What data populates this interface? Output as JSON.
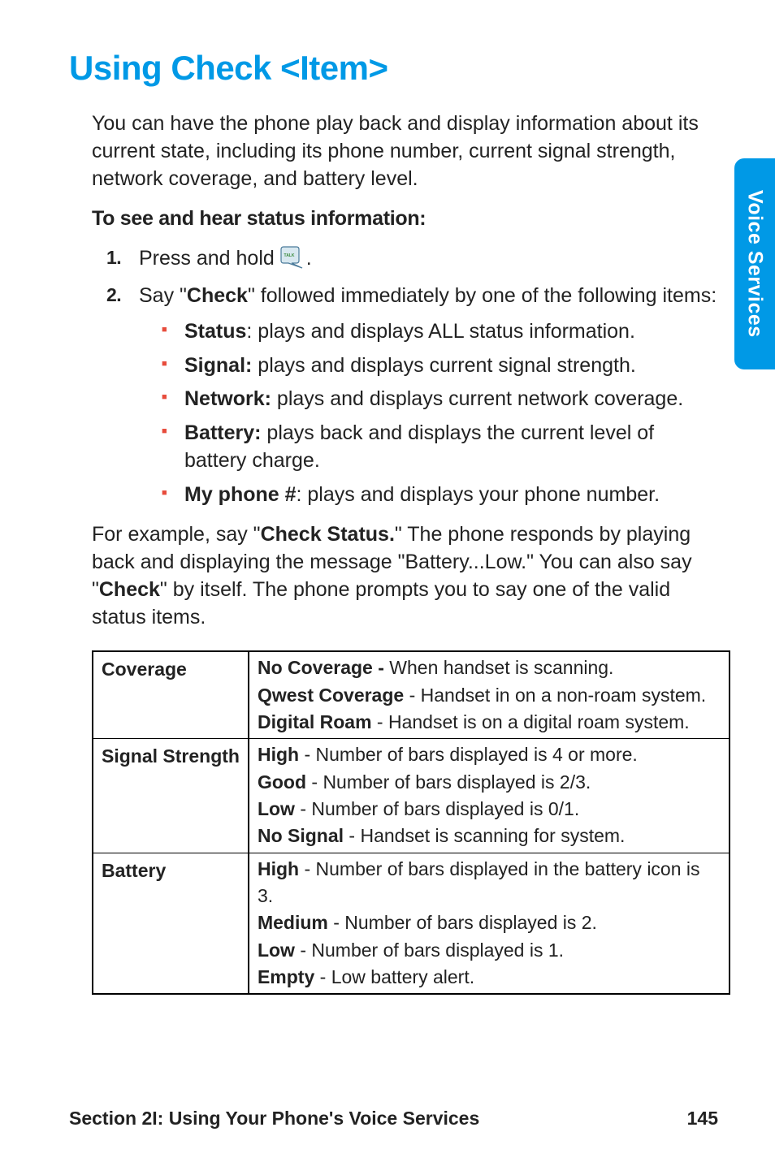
{
  "side_tab": "Voice Services",
  "heading": "Using Check <Item>",
  "intro": "You can have the phone play back and display information about its current state, including its phone number, current signal strength, network coverage, and battery level.",
  "sub": "To see and hear status information:",
  "steps": {
    "s1_pre": "Press and hold ",
    "s1_post": ".",
    "s2_pre": "Say \"",
    "s2_bold": "Check",
    "s2_post": "\" followed immediately by one of the following items:"
  },
  "bullets": {
    "b1_bold": "Status",
    "b1_rest": ": plays and displays ALL status information.",
    "b2_bold": "Signal:",
    "b2_rest": " plays and displays current signal strength.",
    "b3_bold": "Network:",
    "b3_rest": " plays and displays current network coverage.",
    "b4_bold": "Battery:",
    "b4_rest": " plays back and displays the current level of battery charge.",
    "b5_bold": "My phone #",
    "b5_rest": ": plays and displays your phone number."
  },
  "example": {
    "p1": "For example, say \"",
    "p1b": "Check Status.",
    "p2": "\" The phone responds by playing back and displaying the message \"Battery...Low.\" You can also say \"",
    "p2b": "Check",
    "p3": "\" by itself. The phone prompts you to say one of the valid status items."
  },
  "table": {
    "rows": [
      {
        "label": "Coverage",
        "lines": [
          {
            "b": "No Coverage - ",
            "r": "When handset is scanning."
          },
          {
            "b": "Qwest Coverage",
            "r": " - Handset in on a non-roam system."
          },
          {
            "b": "Digital Roam",
            "r": " - Handset is on a digital roam system."
          }
        ]
      },
      {
        "label": "Signal Strength",
        "lines": [
          {
            "b": "High",
            "r": " - Number of bars displayed is 4 or more."
          },
          {
            "b": "Good",
            "r": " - Number of bars displayed is 2/3."
          },
          {
            "b": "Low",
            "r": " - Number of bars displayed is 0/1."
          },
          {
            "b": "No Signal",
            "r": " - Handset is scanning for system."
          }
        ]
      },
      {
        "label": "Battery",
        "lines": [
          {
            "b": "High",
            "r": " - Number of bars displayed in the battery icon is 3."
          },
          {
            "b": "Medium",
            "r": " - Number of bars displayed is 2."
          },
          {
            "b": "Low",
            "r": " - Number of bars displayed is 1."
          },
          {
            "b": "Empty",
            "r": " - Low battery alert."
          }
        ]
      }
    ]
  },
  "footer": {
    "section": "Section 2I: Using Your Phone's Voice Services",
    "page": "145"
  }
}
